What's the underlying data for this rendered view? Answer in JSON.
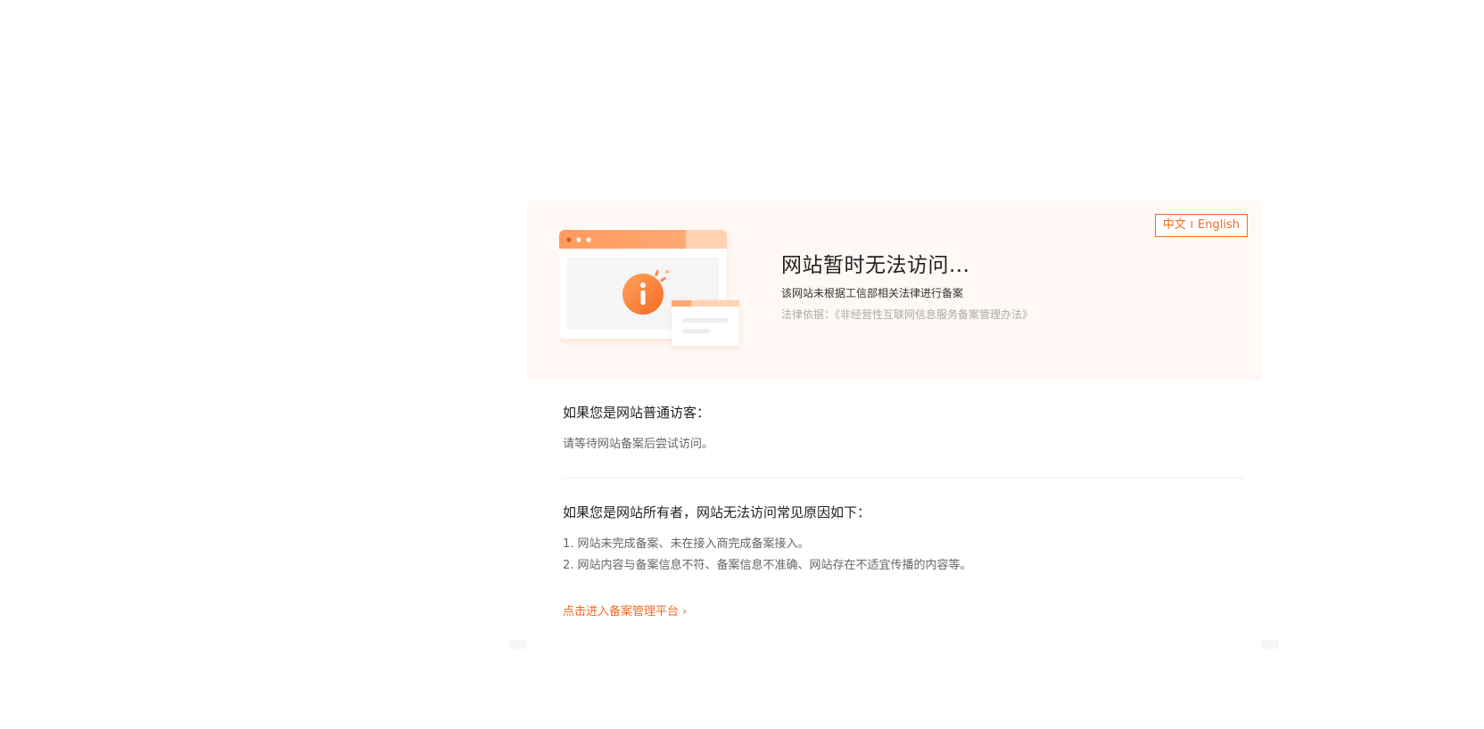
{
  "lang_switch": {
    "zh": "中文",
    "separator": "I",
    "en": "English"
  },
  "banner": {
    "title": "网站暂时无法访问...",
    "subtitle": "该网站未根据工信部相关法律进行备案",
    "law": "法律依据：《非经营性互联网信息服务备案管理办法》"
  },
  "visitor": {
    "heading": "如果您是网站普通访客：",
    "text": "请等待网站备案后尝试访问。"
  },
  "owner": {
    "heading": "如果您是网站所有者，网站无法访问常见原因如下：",
    "reasons": [
      "1. 网站未完成备案、未在接入商完成备案接入。",
      "2. 网站内容与备案信息不符、备案信息不准确、网站存在不适宜传播的内容等。"
    ]
  },
  "link": {
    "label": "点击进入备案管理平台",
    "chevron": "›"
  },
  "colors": {
    "accent": "#f26a21",
    "banner_bg": "#fff8f5",
    "illustration_orange": "#ff9a5c",
    "illustration_light": "#ffd2b3"
  },
  "icons": {
    "illustration": "browser-window-info-icon"
  }
}
